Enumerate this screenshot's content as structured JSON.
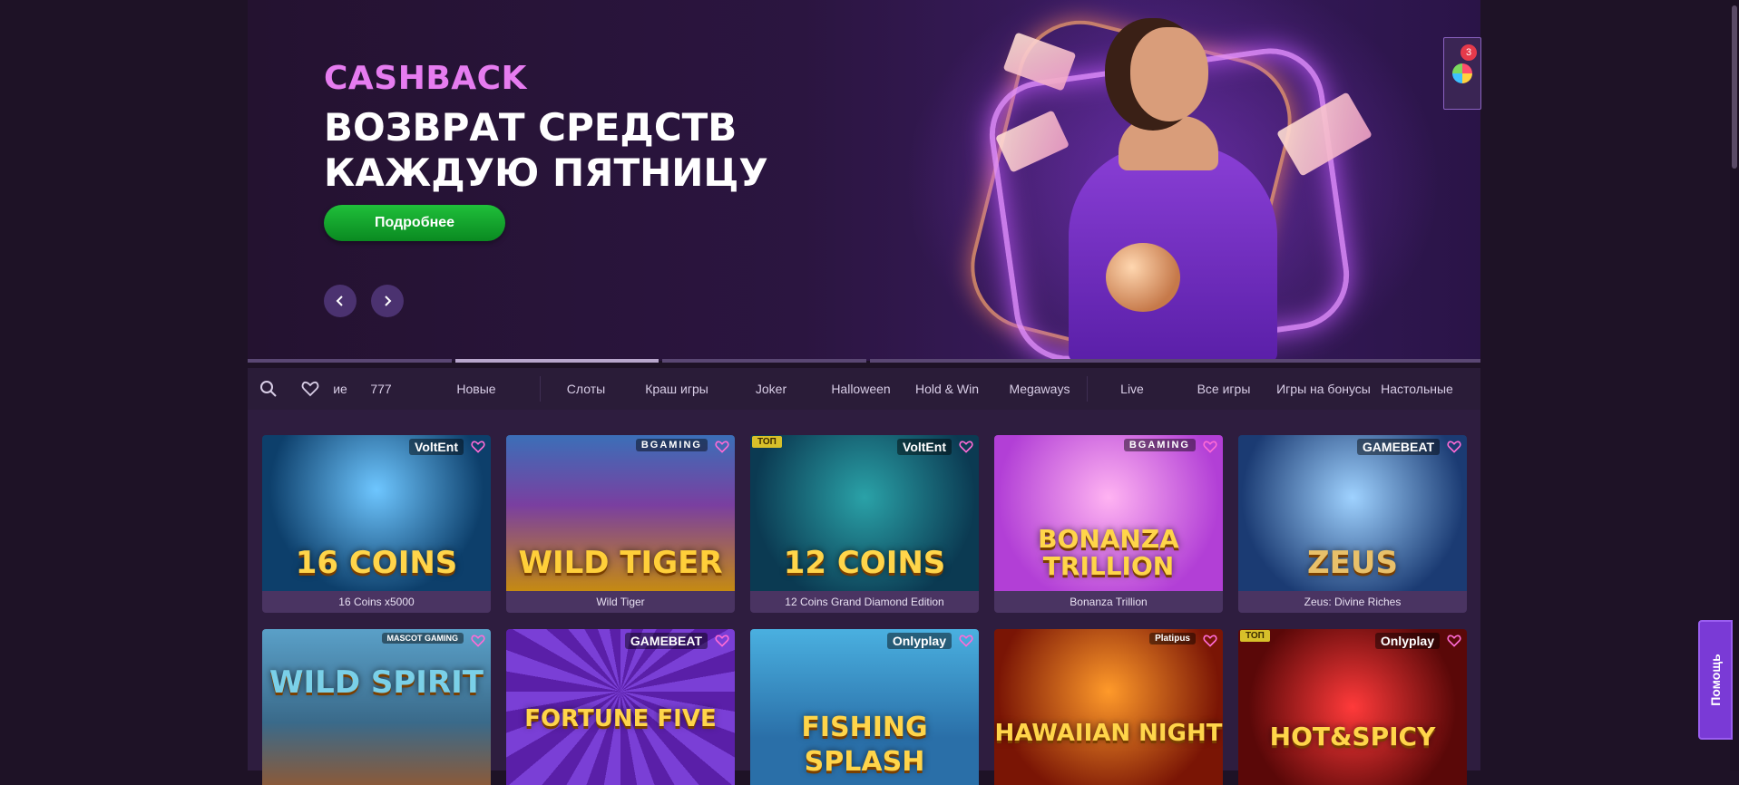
{
  "hero": {
    "kicker": "CASHBACK",
    "title_line1": "ВОЗВРАТ СРЕДСТВ",
    "title_line2": "КАЖДУЮ ПЯТНИЦУ",
    "button_label": "Подробнее"
  },
  "notifications": {
    "count": "3"
  },
  "nav": {
    "items": [
      "ие",
      "777",
      "Новые",
      "Слоты",
      "Краш игры",
      "Joker",
      "Halloween",
      "Hold & Win",
      "Megaways",
      "Live",
      "Все игры",
      "Игры на бонусы",
      "Настольные"
    ]
  },
  "games": [
    {
      "name": "16 Coins x5000",
      "provider": "VoltEnt",
      "art": "16 COINS"
    },
    {
      "name": "Wild Tiger",
      "provider": "BGAMING",
      "art": "WILD TIGER"
    },
    {
      "name": "12 Coins Grand Diamond Edition",
      "provider": "VoltEnt",
      "art": "12 COINS",
      "badge": "ТОП"
    },
    {
      "name": "Bonanza Trillion",
      "provider": "BGAMING",
      "art": "BONANZA TRILLION"
    },
    {
      "name": "Zeus: Divine Riches",
      "provider": "GAMEBEAT",
      "art": "ZEUS"
    },
    {
      "name": "",
      "provider": "MASCOT GAMING",
      "art": "WILD SPIRIT"
    },
    {
      "name": "",
      "provider": "GAMEBEAT",
      "art": "FORTUNE FIVE"
    },
    {
      "name": "",
      "provider": "Onlyplay",
      "art": "FISHING SPLASH"
    },
    {
      "name": "",
      "provider": "Platipus",
      "art": "HAWAIIAN NIGHT"
    },
    {
      "name": "",
      "provider": "Onlyplay",
      "art": "HOT&SPICY",
      "badge": "ТОП"
    }
  ],
  "help": {
    "label": "Помощь"
  }
}
